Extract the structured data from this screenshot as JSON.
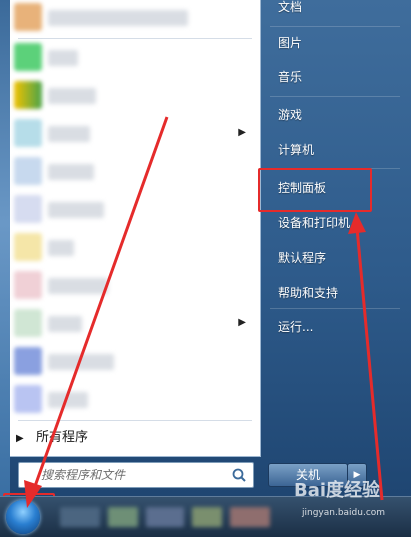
{
  "right_pane": {
    "items": [
      {
        "label": "文档"
      },
      {
        "label": "图片"
      },
      {
        "label": "音乐"
      },
      {
        "label": "游戏"
      },
      {
        "label": "计算机"
      },
      {
        "label": "控制面板"
      },
      {
        "label": "设备和打印机"
      },
      {
        "label": "默认程序"
      },
      {
        "label": "帮助和支持"
      },
      {
        "label": "运行..."
      }
    ],
    "shutdown_label": "关机",
    "shutdown_arrow": "▶"
  },
  "left_pane": {
    "all_programs_label": "所有程序",
    "all_programs_arrow": "▶",
    "search_placeholder": "搜索程序和文件",
    "submenu_arrow": "▶"
  },
  "watermark": {
    "brand": "Bai度经验",
    "url": "jingyan.baidu.com"
  },
  "colors": {
    "highlight": "#e52b2b",
    "menu_blue": "#2e5b8b"
  }
}
